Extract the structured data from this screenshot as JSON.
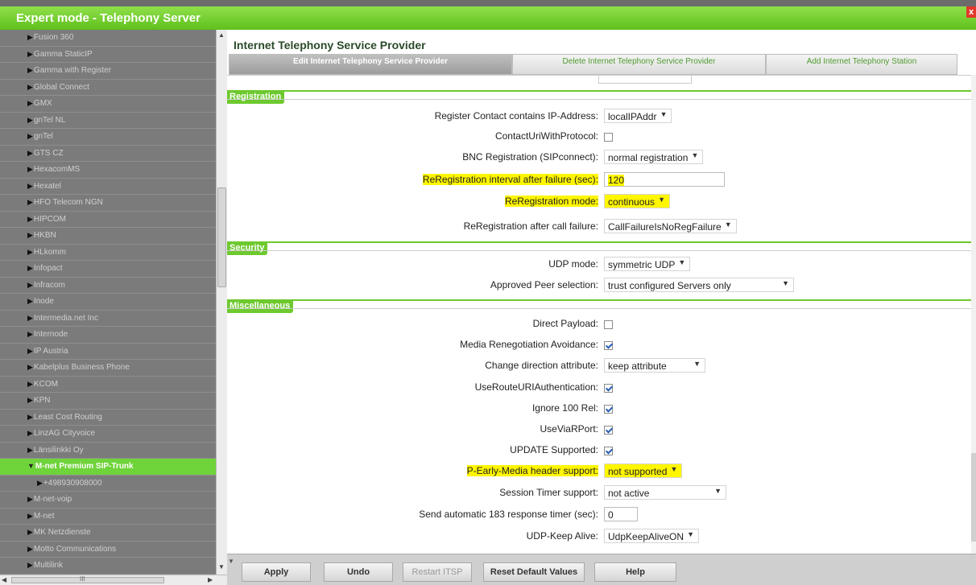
{
  "window": {
    "title": "Expert mode - Telephony Server",
    "close_glyph": "x"
  },
  "sidebar": {
    "items": [
      {
        "label": "Fusion 360"
      },
      {
        "label": "Gamma StaticIP"
      },
      {
        "label": "Gamma with Register"
      },
      {
        "label": "Global Connect"
      },
      {
        "label": "GMX"
      },
      {
        "label": "gnTel NL"
      },
      {
        "label": "gnTel"
      },
      {
        "label": "GTS CZ"
      },
      {
        "label": "HexacomMS"
      },
      {
        "label": "Hexatel"
      },
      {
        "label": "HFO Telecom NGN"
      },
      {
        "label": "HIPCOM"
      },
      {
        "label": "HKBN"
      },
      {
        "label": "HLkomm"
      },
      {
        "label": "Infopact"
      },
      {
        "label": "Infracom"
      },
      {
        "label": "Inode"
      },
      {
        "label": "Intermedia.net Inc"
      },
      {
        "label": "Internode"
      },
      {
        "label": "IP Austria"
      },
      {
        "label": "Kabelplus Business Phone"
      },
      {
        "label": "KCOM"
      },
      {
        "label": "KPN"
      },
      {
        "label": "Least Cost Routing"
      },
      {
        "label": "LinzAG Cityvoice"
      },
      {
        "label": "Länsilinkki Oy"
      },
      {
        "label": "M-net Premium SIP-Trunk",
        "expanded": true
      },
      {
        "label": "+498930908000",
        "child": true
      },
      {
        "label": "M-net-voip"
      },
      {
        "label": "M-net"
      },
      {
        "label": "MK Netzdienste"
      },
      {
        "label": "Motto Communications"
      },
      {
        "label": "Multilink"
      }
    ],
    "hscroll_glyph": "III"
  },
  "main": {
    "title": "Internet Telephony Service Provider",
    "tabs": [
      {
        "label": "Edit Internet Telephony Service Provider",
        "active": true
      },
      {
        "label": "Delete Internet Telephony Service Provider",
        "active": false
      },
      {
        "label": "Add Internet Telephony Station",
        "active": false
      }
    ]
  },
  "sections": {
    "registration": {
      "title": "Registration",
      "register_contact": {
        "label": "Register Contact contains IP-Address:",
        "value": "localIPAddr"
      },
      "contact_uri": {
        "label": "ContactUriWithProtocol:",
        "checked": false
      },
      "bnc_registration": {
        "label": "BNC Registration (SIPconnect):",
        "value": "normal registration"
      },
      "rereg_interval": {
        "label": "ReRegistration interval after failure (sec):",
        "value": "120"
      },
      "rereg_mode": {
        "label": "ReRegistration mode:",
        "value": "continuous"
      },
      "rereg_after_call": {
        "label": "ReRegistration after call failure:",
        "value": "CallFailureIsNoRegFailure"
      }
    },
    "security": {
      "title": "Security",
      "udp_mode": {
        "label": "UDP mode:",
        "value": "symmetric UDP"
      },
      "approved_peer": {
        "label": "Approved Peer selection:",
        "value": "trust configured Servers only"
      }
    },
    "misc": {
      "title": "Miscellaneous",
      "direct_payload": {
        "label": "Direct Payload:",
        "checked": false
      },
      "media_reneg": {
        "label": "Media Renegotiation Avoidance:",
        "checked": true
      },
      "change_direction": {
        "label": "Change direction attribute:",
        "value": "keep attribute"
      },
      "use_route_uri": {
        "label": "UseRouteURIAuthentication:",
        "checked": true
      },
      "ignore_100rel": {
        "label": "Ignore 100 Rel:",
        "checked": true
      },
      "use_via_rport": {
        "label": "UseViaRPort:",
        "checked": true
      },
      "update_supported": {
        "label": "UPDATE Supported:",
        "checked": true
      },
      "p_early_media": {
        "label": "P-Early-Media header support:",
        "value": "not supported"
      },
      "session_timer": {
        "label": "Session Timer support:",
        "value": "not active"
      },
      "send_183": {
        "label": "Send automatic 183 response timer (sec):",
        "value": "0"
      },
      "udp_keepalive": {
        "label": "UDP-Keep Alive:",
        "value": "UdpKeepAliveON"
      }
    }
  },
  "buttons": {
    "apply": "Apply",
    "undo": "Undo",
    "restart": "Restart ITSP",
    "defaults": "Reset Default Values",
    "help": "Help"
  },
  "colors": {
    "accent": "#6dc92e",
    "highlight": "#fff600",
    "sidebar_bg": "#7b7b7b"
  }
}
